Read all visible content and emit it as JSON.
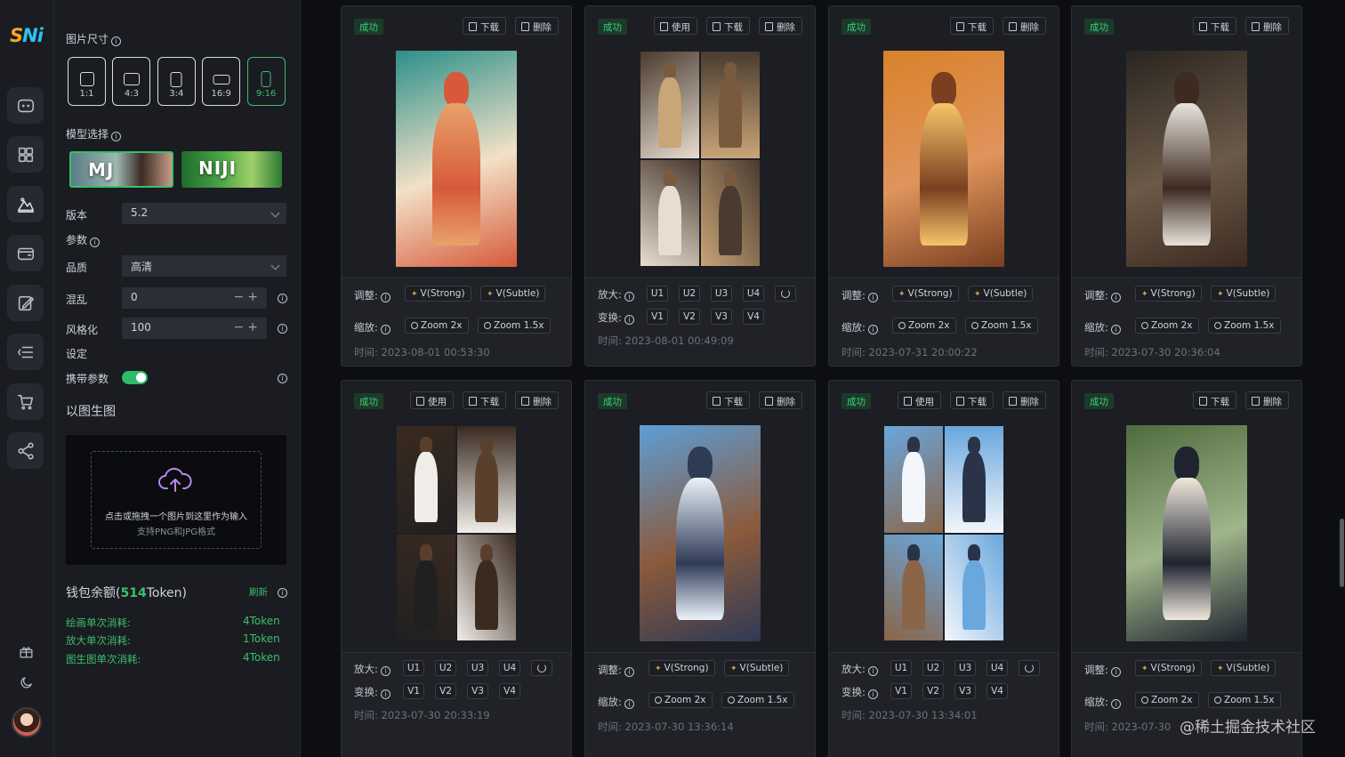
{
  "sidebar": {
    "logo": "SNi",
    "nav_icons": [
      "chat-icon",
      "grid-icon",
      "image-gen-icon",
      "wallet-icon",
      "edit-icon",
      "menu-list-icon",
      "cart-icon",
      "share-icon"
    ],
    "bottom_icons": [
      "gift-icon",
      "moon-icon"
    ]
  },
  "settings": {
    "size_label": "图片尺寸",
    "ratios": [
      {
        "label": "1:1",
        "active": false
      },
      {
        "label": "4:3",
        "active": false
      },
      {
        "label": "3:4",
        "active": false
      },
      {
        "label": "16:9",
        "active": false
      },
      {
        "label": "9:16",
        "active": true
      }
    ],
    "model_label": "模型选择",
    "models": [
      "MJ",
      "NIJI"
    ],
    "version_label": "版本",
    "version_value": "5.2",
    "params_label": "参数",
    "quality_label": "品质",
    "quality_value": "高清",
    "chaos_label": "混乱",
    "chaos_value": "0",
    "stylize_label": "风格化",
    "stylize_value": "100",
    "settings_label": "设定",
    "carry_params_label": "携带参数",
    "carry_params_on": true,
    "img2img_label": "以图生图",
    "upload_text": "点击或拖拽一个图片到这里作为输入",
    "upload_hint": "支持PNG和JPG格式",
    "wallet_prefix": "钱包余额(",
    "wallet_amount": "514",
    "wallet_suffix": "Token)",
    "refresh_label": "刷新",
    "costs": [
      {
        "label": "绘画单次消耗:",
        "value": "4Token"
      },
      {
        "label": "放大单次消耗:",
        "value": "1Token"
      },
      {
        "label": "图生图单次消耗:",
        "value": "4Token"
      }
    ]
  },
  "labels": {
    "success": "成功",
    "use": "使用",
    "download": "下载",
    "delete": "删除",
    "adjust": "调整:",
    "zoom": "缩放:",
    "upscale": "放大:",
    "vary": "变换:",
    "v_strong": "V(Strong)",
    "v_subtle": "V(Subtle)",
    "zoom2x": "Zoom 2x",
    "zoom15x": "Zoom 1.5x",
    "time_prefix": "时间:"
  },
  "cards": [
    {
      "type": "single",
      "use": false,
      "time": "2023-08-01 00:53:30",
      "palette": [
        "#2c8f8a",
        "#e9a26a",
        "#d65a3a",
        "#f2e1c7"
      ]
    },
    {
      "type": "grid",
      "use": true,
      "time": "2023-08-01 00:49:09",
      "palette": [
        "#4a3b30",
        "#c9a577",
        "#7a5a3f",
        "#e8ddd0"
      ]
    },
    {
      "type": "single",
      "use": false,
      "time": "2023-07-31 20:00:22",
      "palette": [
        "#d9822b",
        "#f7c56a",
        "#7a3f20",
        "#e0945c"
      ]
    },
    {
      "type": "single",
      "use": false,
      "time": "2023-07-30 20:36:04",
      "palette": [
        "#2a2520",
        "#e8e4dd",
        "#3d2a20",
        "#6b5a48"
      ]
    },
    {
      "type": "grid",
      "use": true,
      "time": "2023-07-30 20:33:19",
      "palette": [
        "#3a2a20",
        "#f0ede8",
        "#5a3f2c",
        "#202020"
      ]
    },
    {
      "type": "single",
      "use": false,
      "time": "2023-07-30 13:36:14",
      "palette": [
        "#5d9ed6",
        "#eaf3fb",
        "#2f3a55",
        "#8b5a3c"
      ]
    },
    {
      "type": "grid",
      "use": true,
      "time": "2023-07-30 13:34:01",
      "palette": [
        "#6aa7dd",
        "#f3f6fb",
        "#2a3348",
        "#8a6548"
      ]
    },
    {
      "type": "single",
      "use": false,
      "time": "2023-07-30",
      "palette": [
        "#4f6b3e",
        "#efe8dc",
        "#1f2430",
        "#9fb58a"
      ]
    }
  ],
  "watermark": "@稀土掘金技术社区"
}
